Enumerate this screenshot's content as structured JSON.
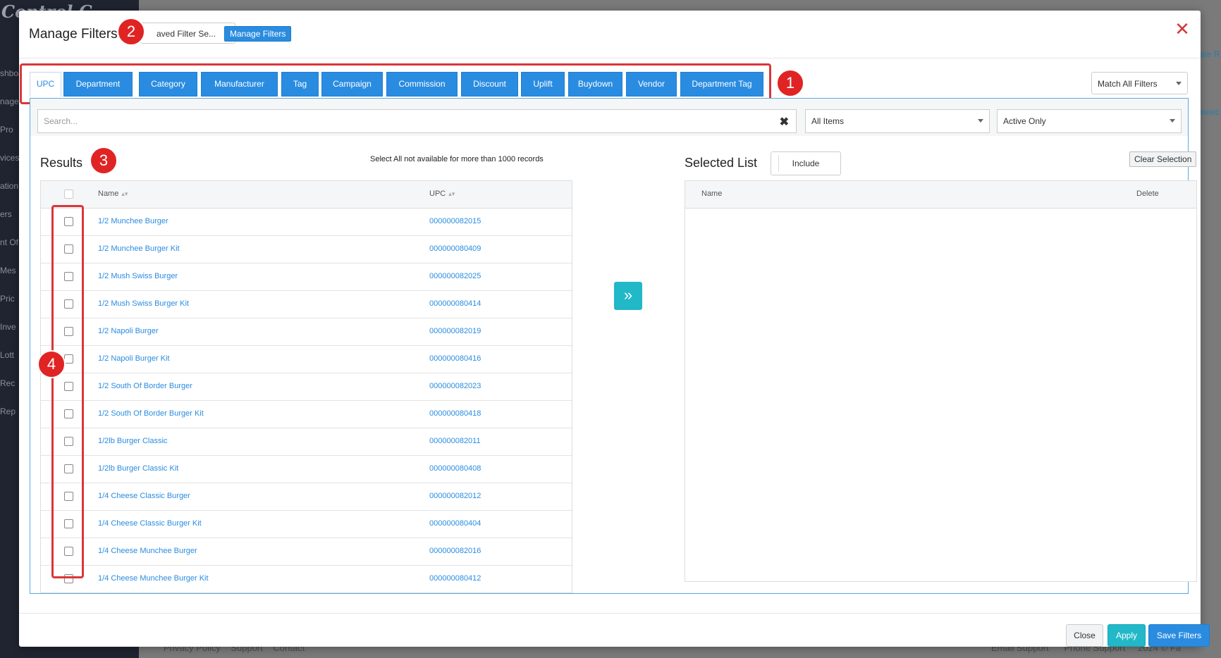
{
  "background": {
    "brand": "Control C",
    "nav_items": [
      "shboa",
      "nage",
      "Pro",
      "vices",
      "ation",
      "ers",
      "nt Of",
      "Mes",
      "Pric",
      "Inve",
      "Lott",
      "Rec",
      "Rep"
    ],
    "footer_left": [
      "Privacy Policy",
      "Support",
      "Contact"
    ],
    "footer_right": [
      "Email Support",
      "Phone Support",
      "2024 © Fa"
    ],
    "right_edge": [
      "ate R",
      "selec"
    ]
  },
  "modal": {
    "title": "Manage Filters",
    "saved_filter_select": "aved Filter Se...",
    "manage_filters_button": "Manage Filters",
    "close_icon": "close-icon"
  },
  "callouts": [
    "1",
    "2",
    "3",
    "4"
  ],
  "tabs": [
    {
      "label": "UPC",
      "active": true
    },
    {
      "label": "Department"
    },
    {
      "label": "Category"
    },
    {
      "label": "Manufacturer"
    },
    {
      "label": "Tag"
    },
    {
      "label": "Campaign"
    },
    {
      "label": "Commission"
    },
    {
      "label": "Discount"
    },
    {
      "label": "Uplift"
    },
    {
      "label": "Buydown"
    },
    {
      "label": "Vendor"
    },
    {
      "label": "Department Tag"
    }
  ],
  "match_select": "Match All Filters",
  "search": {
    "placeholder": "Search..."
  },
  "items_select": "All Items",
  "status_select": "Active Only",
  "results": {
    "title": "Results",
    "note": "Select All not available for more than 1000 records",
    "columns": [
      "Name",
      "UPC"
    ],
    "rows": [
      {
        "name": "1/2 Munchee Burger",
        "upc": "000000082015"
      },
      {
        "name": "1/2 Munchee Burger Kit",
        "upc": "000000080409"
      },
      {
        "name": "1/2 Mush Swiss Burger",
        "upc": "000000082025"
      },
      {
        "name": "1/2 Mush Swiss Burger Kit",
        "upc": "000000080414"
      },
      {
        "name": "1/2 Napoli Burger",
        "upc": "000000082019"
      },
      {
        "name": "1/2 Napoli Burger Kit",
        "upc": "000000080416"
      },
      {
        "name": "1/2 South Of Border Burger",
        "upc": "000000082023"
      },
      {
        "name": "1/2 South Of Border Burger Kit",
        "upc": "000000080418"
      },
      {
        "name": "1/2lb Burger Classic",
        "upc": "000000082011"
      },
      {
        "name": "1/2lb Burger Classic Kit",
        "upc": "000000080408"
      },
      {
        "name": "1/4 Cheese Classic Burger",
        "upc": "000000082012"
      },
      {
        "name": "1/4 Cheese Classic Burger Kit",
        "upc": "000000080404"
      },
      {
        "name": "1/4 Cheese Munchee Burger",
        "upc": "000000082016"
      },
      {
        "name": "1/4 Cheese Munchee Burger Kit",
        "upc": "000000080412"
      }
    ]
  },
  "move_button_icon": "»",
  "selected": {
    "title": "Selected List",
    "include_button": "Include",
    "clear_button": "Clear Selection",
    "columns": [
      "Name",
      "Delete"
    ]
  },
  "footer": {
    "close": "Close",
    "apply": "Apply",
    "save": "Save Filters"
  },
  "colors": {
    "accent": "#2a8ce0",
    "teal": "#21b8c7",
    "callout": "#e02424"
  }
}
